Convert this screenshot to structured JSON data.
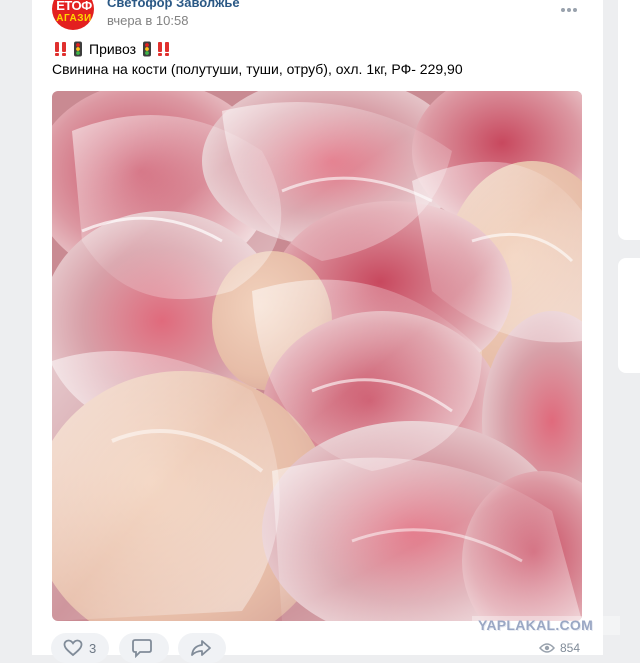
{
  "post": {
    "author": "Светофор Заволжье",
    "time": "вчера в 10:58",
    "title": "Привоз",
    "description": "Свинина на кости (полутуши, туши, отруб), охл. 1кг, РФ- 229,90"
  },
  "avatar": {
    "line1": "ЕТОФ",
    "line2": "АГАЗИ"
  },
  "actions": {
    "likes": "3"
  },
  "views": "854",
  "watermark": "YAPLAKAL.COM",
  "icons": [
    "more-icon",
    "double-exclamation-icon",
    "traffic-light-icon",
    "heart-icon",
    "comment-icon",
    "share-icon",
    "eye-icon"
  ],
  "colors": {
    "author": "#2a5885",
    "accent": "#e3201f",
    "muted": "#828282"
  }
}
